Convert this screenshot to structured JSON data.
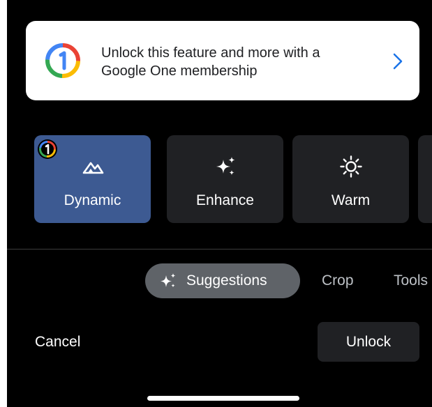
{
  "promo_banner": {
    "text": "Unlock this feature and more with a Google One membership",
    "logo_icon": "google-one-logo-icon",
    "chevron_icon": "chevron-right-icon",
    "chevron_color": "#1a73e8"
  },
  "filters": [
    {
      "label": "Dynamic",
      "icon": "mountain-icon",
      "selected": true,
      "premium_badge": "google-one-badge-icon"
    },
    {
      "label": "Enhance",
      "icon": "sparkle-icon",
      "selected": false
    },
    {
      "label": "Warm",
      "icon": "sun-icon",
      "selected": false
    }
  ],
  "tabs": {
    "suggestions": {
      "label": "Suggestions",
      "icon": "sparkle-icon",
      "active": true
    },
    "crop": {
      "label": "Crop"
    },
    "tools": {
      "label": "Tools"
    }
  },
  "actions": {
    "cancel_label": "Cancel",
    "unlock_label": "Unlock"
  },
  "colors": {
    "background": "#000000",
    "selected_tile": "#3d5a92",
    "tile": "#202124",
    "active_tab": "#5f6368"
  }
}
